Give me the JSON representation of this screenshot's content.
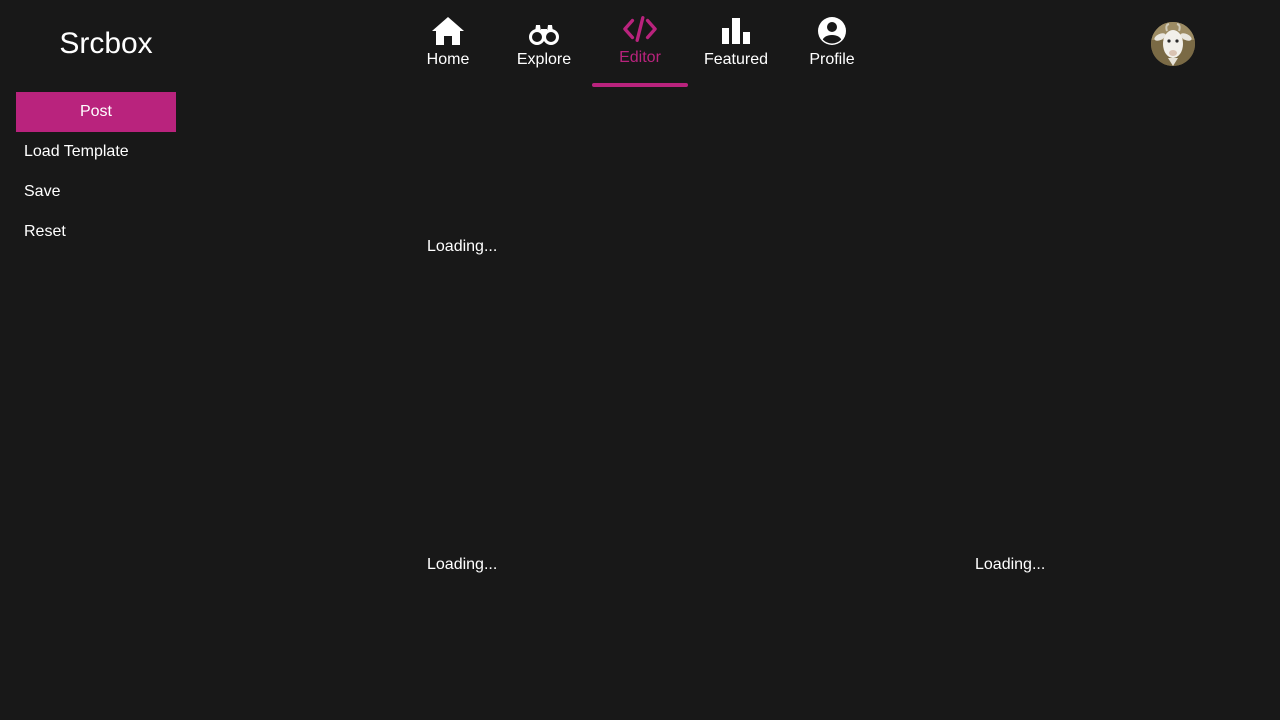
{
  "brand": {
    "name": "Srcbox"
  },
  "sidebar": {
    "items": [
      {
        "label": "Post"
      },
      {
        "label": "Load Template"
      },
      {
        "label": "Save"
      },
      {
        "label": "Reset"
      }
    ]
  },
  "nav": {
    "active": "Editor",
    "items": [
      {
        "label": "Home",
        "icon": "home-icon"
      },
      {
        "label": "Explore",
        "icon": "binoculars-icon"
      },
      {
        "label": "Editor",
        "icon": "code-icon"
      },
      {
        "label": "Featured",
        "icon": "bar-chart-icon"
      },
      {
        "label": "Profile",
        "icon": "user-circle-icon"
      }
    ]
  },
  "avatar": {
    "icon": "goat-avatar"
  },
  "main": {
    "panels": [
      {
        "status": "Loading..."
      },
      {
        "status": "Loading..."
      },
      {
        "status": "Loading..."
      }
    ]
  },
  "colors": {
    "background": "#181818",
    "accent": "#b9237d",
    "text": "#ffffff"
  }
}
